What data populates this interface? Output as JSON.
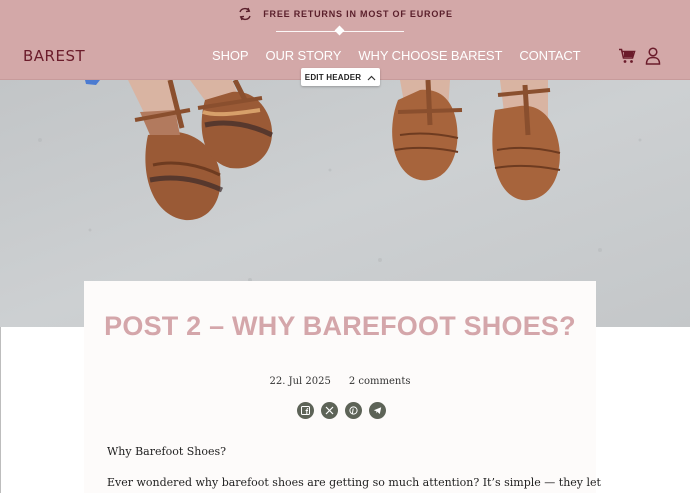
{
  "announcement": {
    "icon": "returns-arrows-icon",
    "text": "FREE RETURNS IN MOST OF EUROPE"
  },
  "logo": {
    "text": "BAREST"
  },
  "nav": {
    "items": [
      "SHOP",
      "OUR STORY",
      "WHY CHOOSE BAREST",
      "CONTACT"
    ]
  },
  "header_icons": {
    "cart": "cart-icon",
    "account": "user-icon"
  },
  "edit_header": {
    "label": "EDIT HEADER",
    "icon": "chevron-up-icon"
  },
  "hero": {
    "description_icon": "hero-image"
  },
  "post": {
    "title": "POST 2 – WHY BAREFOOT SHOES?",
    "date": "22. Jul 2025",
    "comments": "2 comments",
    "share": [
      "facebook-icon",
      "x-icon",
      "pinterest-icon",
      "telegram-icon"
    ],
    "paragraph_1": "Why Barefoot Shoes?",
    "paragraph_2": "Ever wondered why barefoot shoes are getting so much attention? It’s simple — they let"
  },
  "colors": {
    "header_bg": "#d3a8a8",
    "brand": "#6b1c2b",
    "title": "#d4a6aa",
    "share_btn": "#5d6357"
  }
}
